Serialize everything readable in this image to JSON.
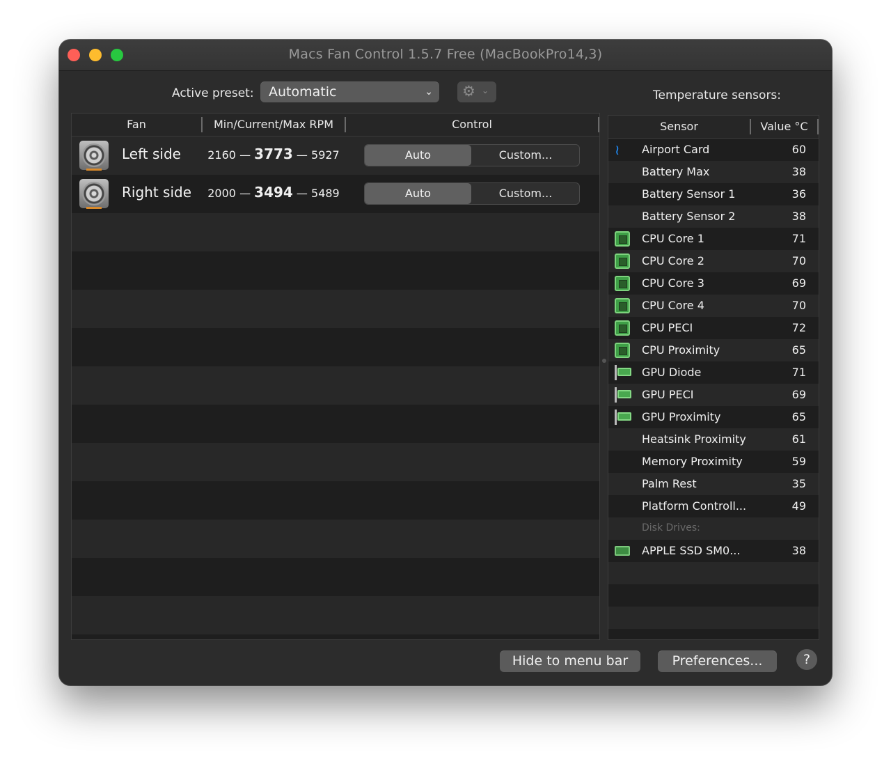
{
  "window": {
    "title": "Macs Fan Control 1.5.7 Free (MacBookPro14,3)"
  },
  "toolbar": {
    "active_preset_label": "Active preset:",
    "preset_value": "Automatic",
    "settings_icon": "gear-icon",
    "temperature_sensors_label": "Temperature sensors:"
  },
  "fans": {
    "headers": {
      "fan": "Fan",
      "rpm": "Min/Current/Max RPM",
      "control": "Control"
    },
    "rows": [
      {
        "name": "Left side",
        "min": "2160",
        "current": "3773",
        "max": "5927",
        "auto_label": "Auto",
        "custom_label": "Custom..."
      },
      {
        "name": "Right side",
        "min": "2000",
        "current": "3494",
        "max": "5489",
        "auto_label": "Auto",
        "custom_label": "Custom..."
      }
    ],
    "dash": "—"
  },
  "sensors": {
    "headers": {
      "sensor": "Sensor",
      "value": "Value °C"
    },
    "rows": [
      {
        "name": "Airport Card",
        "value": "60",
        "icon": "wifi-icon"
      },
      {
        "name": "Battery Max",
        "value": "38",
        "icon": ""
      },
      {
        "name": "Battery Sensor 1",
        "value": "36",
        "icon": ""
      },
      {
        "name": "Battery Sensor 2",
        "value": "38",
        "icon": ""
      },
      {
        "name": "CPU Core 1",
        "value": "71",
        "icon": "cpu-icon"
      },
      {
        "name": "CPU Core 2",
        "value": "70",
        "icon": "cpu-icon"
      },
      {
        "name": "CPU Core 3",
        "value": "69",
        "icon": "cpu-icon"
      },
      {
        "name": "CPU Core 4",
        "value": "70",
        "icon": "cpu-icon"
      },
      {
        "name": "CPU PECI",
        "value": "72",
        "icon": "cpu-icon"
      },
      {
        "name": "CPU Proximity",
        "value": "65",
        "icon": "cpu-icon"
      },
      {
        "name": "GPU Diode",
        "value": "71",
        "icon": "gpu-icon"
      },
      {
        "name": "GPU PECI",
        "value": "69",
        "icon": "gpu-icon"
      },
      {
        "name": "GPU Proximity",
        "value": "65",
        "icon": "gpu-icon"
      },
      {
        "name": "Heatsink Proximity",
        "value": "61",
        "icon": ""
      },
      {
        "name": "Memory Proximity",
        "value": "59",
        "icon": ""
      },
      {
        "name": "Palm Rest",
        "value": "35",
        "icon": ""
      },
      {
        "name": "Platform Controll...",
        "value": "49",
        "icon": ""
      }
    ],
    "disk_group_label": "Disk Drives:",
    "disk_rows": [
      {
        "name": "APPLE SSD SM0...",
        "value": "38",
        "icon": "ssd-icon"
      }
    ]
  },
  "footer": {
    "hide_label": "Hide to menu bar",
    "preferences_label": "Preferences...",
    "help_label": "?"
  }
}
